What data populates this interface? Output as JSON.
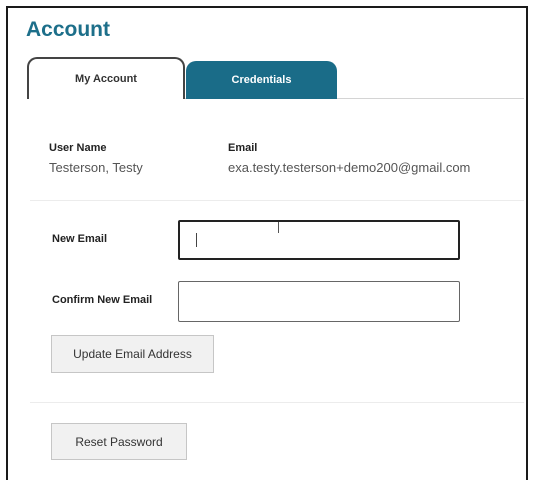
{
  "page": {
    "title": "Account"
  },
  "tabs": [
    {
      "label": "My Account",
      "active": true
    },
    {
      "label": "Credentials",
      "active": false
    }
  ],
  "user_info": {
    "user_name_label": "User Name",
    "user_name_value": "Testerson, Testy",
    "email_label": "Email",
    "email_value": "exa.testy.testerson+demo200@gmail.com"
  },
  "form": {
    "new_email_label": "New Email",
    "new_email_value": "",
    "confirm_email_label": "Confirm New Email",
    "confirm_email_value": "",
    "update_button": "Update Email Address",
    "reset_button": "Reset Password"
  },
  "colors": {
    "accent": "#1d6f8a",
    "tab_inactive_bg": "#1a6c88"
  }
}
